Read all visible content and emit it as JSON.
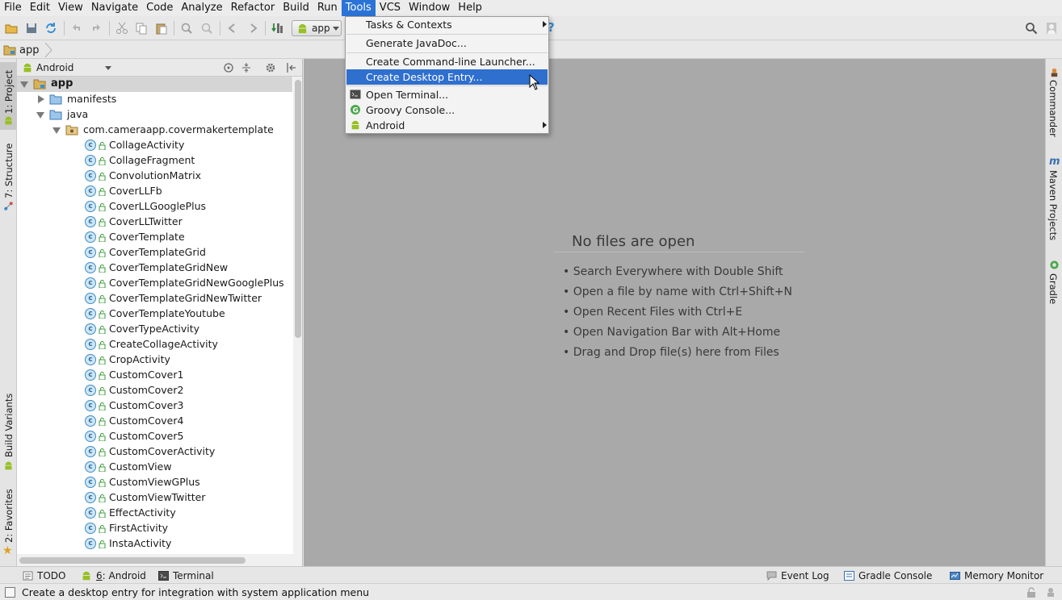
{
  "menubar": {
    "items": [
      {
        "label": "File"
      },
      {
        "label": "Edit"
      },
      {
        "label": "View"
      },
      {
        "label": "Navigate"
      },
      {
        "label": "Code"
      },
      {
        "label": "Analyze"
      },
      {
        "label": "Refactor"
      },
      {
        "label": "Build"
      },
      {
        "label": "Run"
      },
      {
        "label": "Tools"
      },
      {
        "label": "VCS"
      },
      {
        "label": "Window"
      },
      {
        "label": "Help"
      }
    ],
    "active": "Tools"
  },
  "toolbar": {
    "run_config": "app"
  },
  "navbar": {
    "crumb": "app"
  },
  "left_tabs": {
    "project": "1: Project",
    "structure": "7: Structure",
    "build_variants": "Build Variants",
    "favorites": "2: Favorites"
  },
  "right_tabs": {
    "commander": "Commander",
    "maven": "Maven Projects",
    "gradle": "Gradle"
  },
  "project_panel": {
    "view_mode": "Android",
    "root": "app",
    "folders": [
      "manifests",
      "java",
      "com.cameraapp.covermakertemplate"
    ],
    "classes": [
      "CollageActivity",
      "CollageFragment",
      "ConvolutionMatrix",
      "CoverLLFb",
      "CoverLLGooglePlus",
      "CoverLLTwitter",
      "CoverTemplate",
      "CoverTemplateGrid",
      "CoverTemplateGridNew",
      "CoverTemplateGridNewGooglePlus",
      "CoverTemplateGridNewTwitter",
      "CoverTemplateYoutube",
      "CoverTypeActivity",
      "CreateCollageActivity",
      "CropActivity",
      "CustomCover1",
      "CustomCover2",
      "CustomCover3",
      "CustomCover4",
      "CustomCover5",
      "CustomCoverActivity",
      "CustomView",
      "CustomViewGPlus",
      "CustomViewTwitter",
      "EffectActivity",
      "FirstActivity",
      "InstaActivity"
    ]
  },
  "editor": {
    "title": "No files are open",
    "hints": [
      "• Search Everywhere with Double Shift",
      "• Open a file by name with Ctrl+Shift+N",
      "• Open Recent Files with Ctrl+E",
      "• Open Navigation Bar with Alt+Home",
      "• Drag and Drop file(s) here from Files"
    ]
  },
  "tools_menu": {
    "tasks": "Tasks & Contexts",
    "javadoc": "Generate JavaDoc...",
    "cli_launcher": "Create Command-line Launcher...",
    "desktop_entry": "Create Desktop Entry...",
    "terminal": "Open Terminal...",
    "groovy": "Groovy Console...",
    "android": "Android"
  },
  "bottom_tabs": {
    "todo": "TODO",
    "android_num": "6",
    "android": ": Android",
    "terminal": "Terminal",
    "event_log": "Event Log",
    "gradle_console": "Gradle Console",
    "memory_monitor": "Memory Monitor"
  },
  "status": {
    "text": "Create a desktop entry for integration with system application menu"
  },
  "colors": {
    "menu_highlight": "#2f6fce",
    "editor_bg": "#a9a9a9",
    "class_icon": "#3d8bc7",
    "android_green": "#97c024"
  }
}
